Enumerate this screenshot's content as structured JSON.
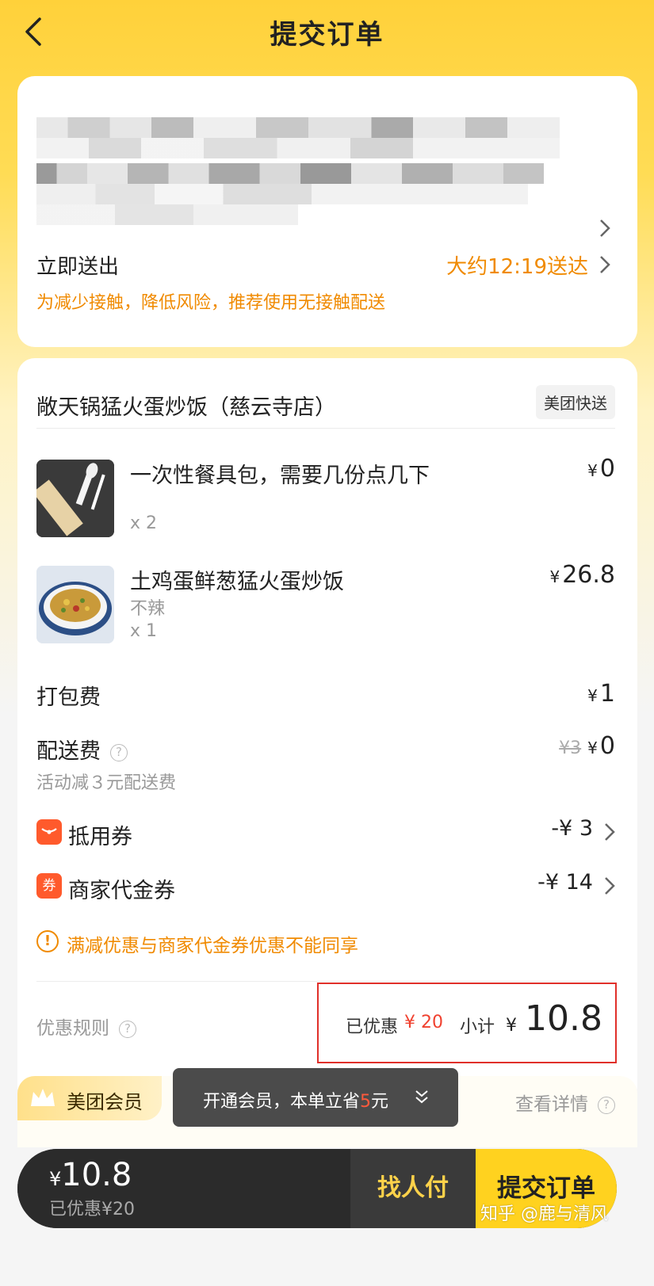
{
  "header": {
    "title": "提交订单",
    "back_icon": "back-arrow-icon"
  },
  "address": {
    "redacted": true,
    "delivery_label": "立即送出",
    "eta": "大约12:19送达",
    "notice": "为减少接触，降低风险，推荐使用无接触配送"
  },
  "order": {
    "shop_name": "敞天锅猛火蛋炒饭（慈云寺店）",
    "shop_badge": "美团快送",
    "items": [
      {
        "name": "一次性餐具包，需要几份点几下",
        "spec": "",
        "qty": "x 2",
        "price": "0",
        "image_icon": "tableware-pack-image"
      },
      {
        "name": "土鸡蛋鲜葱猛火蛋炒饭",
        "spec": "不辣",
        "qty": "x 1",
        "price": "26.8",
        "image_icon": "fried-rice-image"
      }
    ],
    "packing_label": "打包费",
    "packing_price": "1",
    "delivery_fee_label": "配送费",
    "delivery_fee_original": "¥3",
    "delivery_fee_price": "0",
    "delivery_fee_note": "活动减３元配送费",
    "coupon_label": "抵用券",
    "coupon_value": "-¥ 3",
    "voucher_label": "商家代金券",
    "voucher_icon_text": "券",
    "voucher_value": "-¥ 14",
    "warning": "满减优惠与商家代金券优惠不能同享",
    "rules_label": "优惠规则",
    "discounted_label": "已优惠",
    "discounted_value": "¥ 20",
    "subtotal_label": "小计",
    "subtotal_value": "10.8",
    "yen": "¥"
  },
  "member": {
    "tag": "美团会员",
    "more": "查看详情",
    "toast_prefix": "开通会员，本单立省",
    "toast_amount": "5",
    "toast_suffix": "元"
  },
  "paybar": {
    "yen": "¥",
    "total": "10.8",
    "discount_text": "已优惠¥20",
    "ask_pay": "找人付",
    "submit": "提交订单"
  },
  "watermark": "知乎 @鹿与清风",
  "colors": {
    "brand_yellow": "#ffd21f",
    "orange": "#f08a00",
    "red": "#f0412f"
  }
}
